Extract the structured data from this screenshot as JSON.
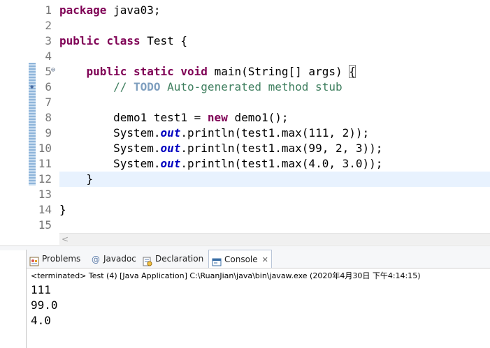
{
  "editor": {
    "line_numbers": [
      "1",
      "2",
      "3",
      "4",
      "5",
      "6",
      "7",
      "8",
      "9",
      "10",
      "11",
      "12",
      "13",
      "14",
      "15"
    ],
    "lines": [
      [
        "package",
        " java03;"
      ],
      [],
      [
        "public",
        " ",
        "class",
        " Test {"
      ],
      [],
      [
        "    ",
        "public",
        " ",
        "static",
        " ",
        "void",
        " main(String[] args) ",
        "{"
      ],
      [
        "        ",
        "// ",
        "TODO",
        " Auto-generated method stub"
      ],
      [],
      [
        "        demo1 test1 = ",
        "new",
        " demo1();"
      ],
      [
        "        System.",
        "out",
        ".println(test1.max(111, 2));"
      ],
      [
        "        System.",
        "out",
        ".println(test1.max(99, 2, 3));"
      ],
      [
        "        System.",
        "out",
        ".println(test1.max(4.0, 3.0));"
      ],
      [
        "    }"
      ],
      [],
      [
        "}"
      ],
      []
    ],
    "fold_marker": "⊖",
    "scroll_arrow": "<"
  },
  "panel": {
    "tabs": {
      "problems": "Problems",
      "javadoc": "Javadoc",
      "declaration": "Declaration",
      "console": "Console",
      "close": "✕"
    },
    "javadoc_glyph": "@",
    "status": "<terminated> Test (4) [Java Application] C:\\RuanJian\\java\\bin\\javaw.exe (2020年4月30日 下午4:14:15)",
    "output": [
      "111",
      "99.0",
      "4.0"
    ]
  },
  "colors": {
    "keyword": "#7f0055",
    "comment": "#3f7f5f",
    "todo": "#7f9fbf",
    "field": "#0000c0",
    "current_line": "#e8f2fe"
  }
}
